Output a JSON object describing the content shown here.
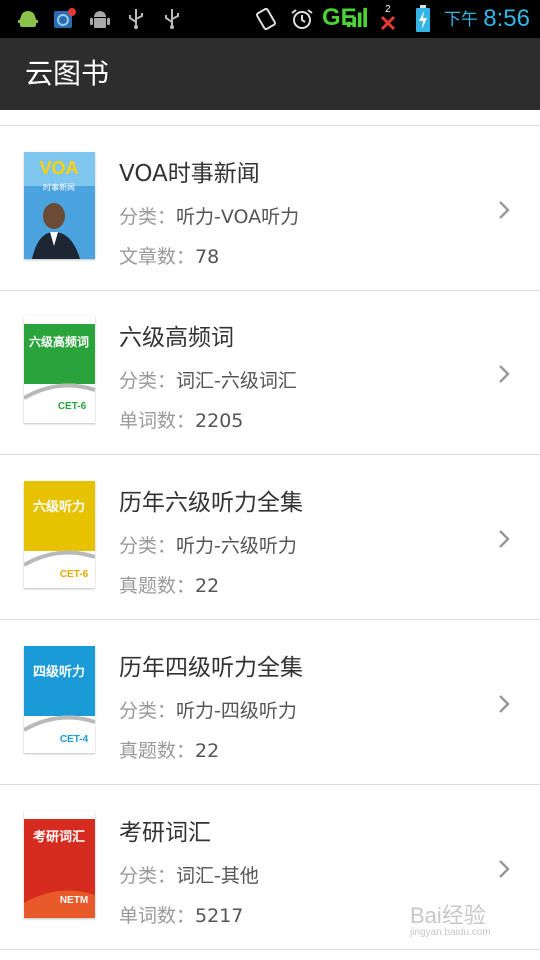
{
  "status_bar": {
    "network": "GE",
    "ampm": "下午",
    "time": "8:56",
    "sim_label": "2"
  },
  "action_bar": {
    "title": "云图书"
  },
  "books": [
    {
      "title": "VOA时事新闻",
      "category_label": "分类：",
      "category_value": "听力-VOA听力",
      "count_label": "文章数：",
      "count_value": "78",
      "cover": {
        "type": "voa",
        "main": "VOA",
        "sub": "时事新闻"
      }
    },
    {
      "title": "六级高频词",
      "category_label": "分类：",
      "category_value": "词汇-六级词汇",
      "count_label": "单词数：",
      "count_value": "2205",
      "cover": {
        "type": "green",
        "main": "六级高频词",
        "sub": "CET-6"
      }
    },
    {
      "title": "历年六级听力全集",
      "category_label": "分类：",
      "category_value": "听力-六级听力",
      "count_label": "真题数：",
      "count_value": "22",
      "cover": {
        "type": "yellow",
        "main": "六级听力",
        "sub": "CET-6"
      }
    },
    {
      "title": "历年四级听力全集",
      "category_label": "分类：",
      "category_value": "听力-四级听力",
      "count_label": "真题数：",
      "count_value": "22",
      "cover": {
        "type": "blue",
        "main": "四级听力",
        "sub": "CET-4"
      }
    },
    {
      "title": "考研词汇",
      "category_label": "分类：",
      "category_value": "词汇-其他",
      "count_label": "单词数：",
      "count_value": "5217",
      "cover": {
        "type": "red",
        "main": "考研词汇",
        "sub": "NETM"
      }
    }
  ],
  "watermark": {
    "text": "Bai经验",
    "sub": "jingyan.baidu.com"
  }
}
